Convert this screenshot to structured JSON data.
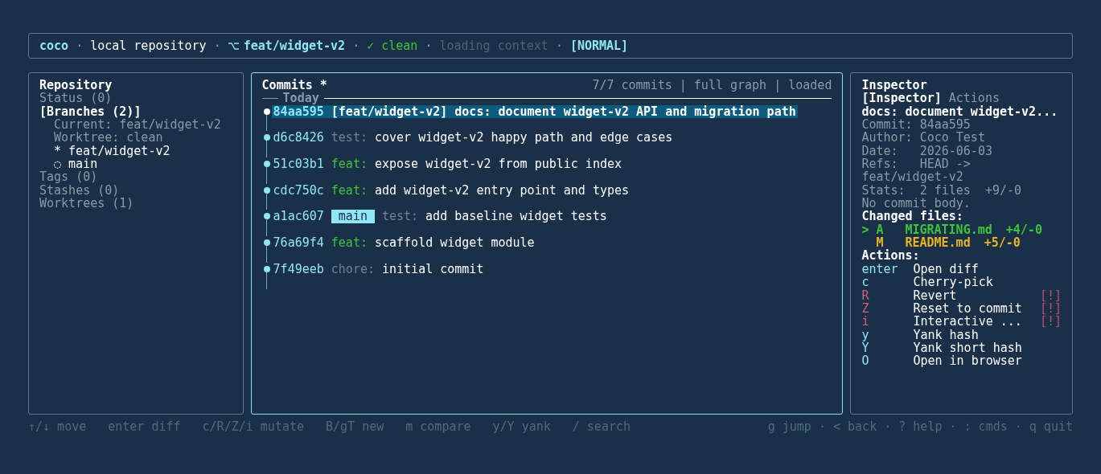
{
  "header": {
    "items": [
      {
        "kind": "brand",
        "text": "coco"
      },
      {
        "kind": "sep",
        "text": "·"
      },
      {
        "kind": "plain",
        "text": "local repository"
      },
      {
        "kind": "sep",
        "text": "·"
      },
      {
        "kind": "branch",
        "text": "feat/widget-v2"
      },
      {
        "kind": "sep",
        "text": "·"
      },
      {
        "kind": "ok",
        "text": "✓ clean"
      },
      {
        "kind": "sep",
        "text": "·"
      },
      {
        "kind": "dim",
        "text": "loading context"
      },
      {
        "kind": "sep",
        "text": "·"
      },
      {
        "kind": "mode",
        "text": "[NORMAL]"
      }
    ]
  },
  "sidebar": {
    "title": "Repository",
    "items": [
      {
        "label": "Status (0)",
        "selected": false
      },
      {
        "label": "[Branches (2)]",
        "selected": true,
        "children": [
          {
            "kind": "info",
            "text": "Current: feat/widget-v2"
          },
          {
            "kind": "info",
            "text": "Worktree: clean"
          },
          {
            "kind": "branch",
            "text": "* feat/widget-v2"
          },
          {
            "kind": "branch",
            "text": "◌ main"
          }
        ]
      },
      {
        "label": "Tags (0)",
        "selected": false
      },
      {
        "label": "Stashes (0)",
        "selected": false
      },
      {
        "label": "Worktrees (1)",
        "selected": false
      }
    ]
  },
  "commits": {
    "title": "Commits *",
    "stats": "7/7 commits | full graph | loaded",
    "group": "Today",
    "rows": [
      {
        "hash": "84aa595",
        "ref": {
          "kind": "head",
          "text": "[feat/widget-v2]"
        },
        "type": "docs:",
        "subject": "document widget-v2 API and migration path",
        "selected": true
      },
      {
        "hash": "d6c8426",
        "type": "test:",
        "color": "#6f8494",
        "subject": "cover widget-v2 happy path and edge cases",
        "selected": false
      },
      {
        "hash": "51c03b1",
        "type": "feat:",
        "color": "#3ec43a",
        "subject": "expose widget-v2 from public index",
        "selected": false
      },
      {
        "hash": "cdc750c",
        "type": "feat:",
        "color": "#3ec43a",
        "subject": "add widget-v2 entry point and types",
        "selected": false
      },
      {
        "hash": "a1ac607",
        "ref": {
          "kind": "badge",
          "text": "main"
        },
        "type": "test:",
        "color": "#6f8494",
        "subject": "add baseline widget tests",
        "selected": false
      },
      {
        "hash": "76a69f4",
        "type": "feat:",
        "color": "#3ec43a",
        "subject": "scaffold widget module",
        "selected": false
      },
      {
        "hash": "7f49eeb",
        "type": "chore:",
        "color": "#6f8494",
        "subject": "initial commit",
        "selected": false
      }
    ]
  },
  "inspector": {
    "title": "Inspector",
    "tabs": [
      {
        "label": "[Inspector]",
        "selected": true
      },
      {
        "label": "Actions",
        "selected": false
      }
    ],
    "subject": "docs: document widget-v2...",
    "details": [
      "Commit: 84aa595",
      "Author: Coco Test",
      "Date:   2026-06-03",
      "Refs:   HEAD ->",
      "feat/widget-v2",
      "Stats:  2 files  +9/-0",
      "No commit body."
    ],
    "files_heading": "Changed files:",
    "files": [
      {
        "cursor": ">",
        "status": "A",
        "name": "MIGRATING.md",
        "stat": "+4/-0",
        "color": "#3ec43a"
      },
      {
        "status": "M",
        "name": "README.md",
        "stat": "+5/-0",
        "color": "#e8b422"
      }
    ],
    "actions_heading": "Actions:",
    "actions": [
      {
        "key": "enter",
        "label": "Open diff",
        "danger": false
      },
      {
        "key": "c",
        "label": "Cherry-pick",
        "danger": false
      },
      {
        "key": "R",
        "label": "Revert",
        "danger": true,
        "warning": "[!]"
      },
      {
        "key": "Z",
        "label": "Reset to commit",
        "danger": true,
        "warning": "[!]"
      },
      {
        "key": "i",
        "label": "Interactive ...",
        "danger": true,
        "warning": "[!]"
      },
      {
        "key": "y",
        "label": "Yank hash",
        "danger": false
      },
      {
        "key": "Y",
        "label": "Yank short hash",
        "danger": false
      },
      {
        "key": "O",
        "label": "Open in browser",
        "danger": false
      }
    ]
  },
  "footer": {
    "left": [
      "↑/↓ move",
      "enter diff",
      "c/R/Z/i mutate",
      "B/gT new",
      "m compare",
      "y/Y yank",
      "/ search"
    ],
    "right": "g jump · < back · ? help · : cmds · q quit"
  }
}
